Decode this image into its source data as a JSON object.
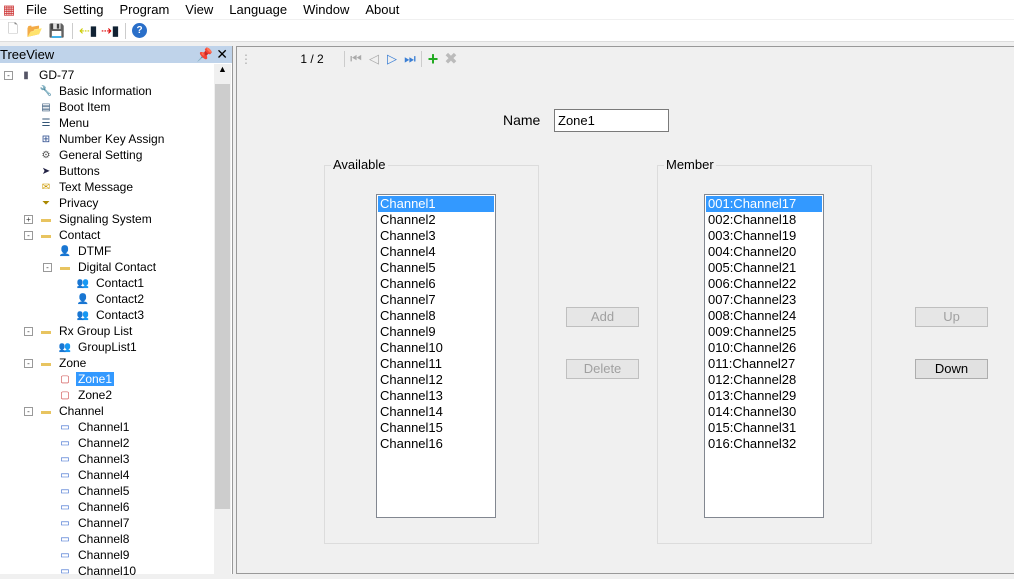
{
  "menu": [
    "File",
    "Setting",
    "Program",
    "View",
    "Language",
    "Window",
    "About"
  ],
  "toolbar": {
    "icons": [
      "new-file-icon",
      "open-folder-icon",
      "save-icon",
      "read-from-radio-icon",
      "write-to-radio-icon",
      "help-icon"
    ]
  },
  "tree": {
    "title": "TreeView",
    "items": [
      {
        "label": "GD-77",
        "level": 0,
        "exp": "-",
        "icon": "radio"
      },
      {
        "label": "Basic Information",
        "level": 1,
        "icon": "wrench"
      },
      {
        "label": "Boot Item",
        "level": 1,
        "icon": "doc"
      },
      {
        "label": "Menu",
        "level": 1,
        "icon": "list"
      },
      {
        "label": "Number Key Assign",
        "level": 1,
        "icon": "keys"
      },
      {
        "label": "General Setting",
        "level": 1,
        "icon": "gear"
      },
      {
        "label": "Buttons",
        "level": 1,
        "icon": "cursor"
      },
      {
        "label": "Text Message",
        "level": 1,
        "icon": "mail"
      },
      {
        "label": "Privacy",
        "level": 1,
        "icon": "filter"
      },
      {
        "label": "Signaling System",
        "level": 1,
        "exp": "+",
        "icon": "folder"
      },
      {
        "label": "Contact",
        "level": 1,
        "exp": "-",
        "icon": "folder"
      },
      {
        "label": "DTMF",
        "level": 2,
        "icon": "person"
      },
      {
        "label": "Digital Contact",
        "level": 2,
        "exp": "-",
        "icon": "folder"
      },
      {
        "label": "Contact1",
        "level": 3,
        "icon": "group"
      },
      {
        "label": "Contact2",
        "level": 3,
        "icon": "person"
      },
      {
        "label": "Contact3",
        "level": 3,
        "icon": "group"
      },
      {
        "label": "Rx Group List",
        "level": 1,
        "exp": "-",
        "icon": "folder"
      },
      {
        "label": "GroupList1",
        "level": 2,
        "icon": "group"
      },
      {
        "label": "Zone",
        "level": 1,
        "exp": "-",
        "icon": "folder"
      },
      {
        "label": "Zone1",
        "level": 2,
        "icon": "zone",
        "selected": true
      },
      {
        "label": "Zone2",
        "level": 2,
        "icon": "zone"
      },
      {
        "label": "Channel",
        "level": 1,
        "exp": "-",
        "icon": "folder"
      },
      {
        "label": "Channel1",
        "level": 2,
        "icon": "channel"
      },
      {
        "label": "Channel2",
        "level": 2,
        "icon": "channel"
      },
      {
        "label": "Channel3",
        "level": 2,
        "icon": "channel"
      },
      {
        "label": "Channel4",
        "level": 2,
        "icon": "channel"
      },
      {
        "label": "Channel5",
        "level": 2,
        "icon": "channel"
      },
      {
        "label": "Channel6",
        "level": 2,
        "icon": "channel"
      },
      {
        "label": "Channel7",
        "level": 2,
        "icon": "channel"
      },
      {
        "label": "Channel8",
        "level": 2,
        "icon": "channel"
      },
      {
        "label": "Channel9",
        "level": 2,
        "icon": "channel"
      },
      {
        "label": "Channel10",
        "level": 2,
        "icon": "channel"
      }
    ]
  },
  "nav": {
    "page": "1 / 2"
  },
  "form": {
    "name_label": "Name",
    "name_value": "Zone1",
    "available_label": "Available",
    "member_label": "Member",
    "available": [
      "Channel1",
      "Channel2",
      "Channel3",
      "Channel4",
      "Channel5",
      "Channel6",
      "Channel7",
      "Channel8",
      "Channel9",
      "Channel10",
      "Channel11",
      "Channel12",
      "Channel13",
      "Channel14",
      "Channel15",
      "Channel16"
    ],
    "members": [
      "001:Channel17",
      "002:Channel18",
      "003:Channel19",
      "004:Channel20",
      "005:Channel21",
      "006:Channel22",
      "007:Channel23",
      "008:Channel24",
      "009:Channel25",
      "010:Channel26",
      "011:Channel27",
      "012:Channel28",
      "013:Channel29",
      "014:Channel30",
      "015:Channel31",
      "016:Channel32"
    ],
    "add": "Add",
    "delete": "Delete",
    "up": "Up",
    "down": "Down"
  }
}
